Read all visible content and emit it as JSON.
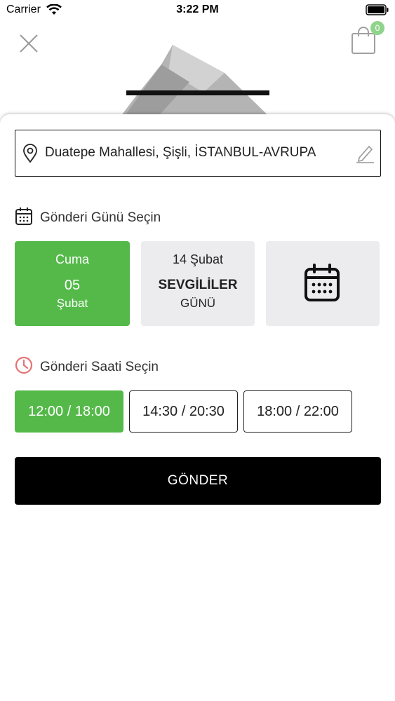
{
  "status_bar": {
    "carrier": "Carrier",
    "time": "3:22 PM"
  },
  "header": {
    "close_icon": "close-icon",
    "cart_icon": "shopping-bag-icon",
    "cart_count": "0"
  },
  "address": {
    "text": "Duatepe Mahallesi, Şişli, İSTANBUL-AVRUPA",
    "pin_icon": "location-pin-icon",
    "edit_icon": "pencil-icon"
  },
  "delivery_day": {
    "title": "Gönderi Günü Seçin",
    "icon": "calendar-icon",
    "options": [
      {
        "line1": "Cuma",
        "line2": "05",
        "line3": "Şubat",
        "selected": true
      },
      {
        "line1": "14 Şubat",
        "line2": "SEVGİLİLER",
        "line3": "GÜNÜ",
        "selected": false
      },
      {
        "icon": "calendar-icon",
        "selected": false
      }
    ]
  },
  "delivery_time": {
    "title": "Gönderi Saati Seçin",
    "icon": "clock-icon",
    "options": [
      {
        "label": "12:00 / 18:00",
        "selected": true
      },
      {
        "label": "14:30 / 20:30",
        "selected": false
      },
      {
        "label": "18:00 / 22:00",
        "selected": false
      }
    ]
  },
  "submit": {
    "label": "GÖNDER"
  },
  "colors": {
    "accent": "#54b949",
    "badge": "#8fd48a",
    "clock": "#e57373",
    "card_bg": "#ececee"
  }
}
